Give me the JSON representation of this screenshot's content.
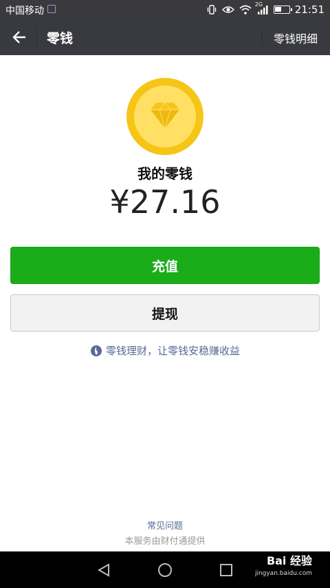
{
  "status_bar": {
    "carrier": "中国移动",
    "network": "2G",
    "battery_level": 0.45,
    "time": "21:51"
  },
  "title_bar": {
    "back_icon": "arrow-left-icon",
    "title": "零钱",
    "detail_link": "零钱明细"
  },
  "wallet": {
    "icon": "diamond-coin-icon",
    "label": "我的零钱",
    "balance": "¥27.16"
  },
  "actions": {
    "recharge_label": "充值",
    "withdraw_label": "提现"
  },
  "promo": {
    "icon": "licaitong-icon",
    "text": "零钱理财，让零钱安稳赚收益"
  },
  "footer": {
    "faq": "常见问题",
    "provider": "本服务由财付通提供"
  },
  "nav_bar": {
    "back": "triangle-back-icon",
    "home": "circle-home-icon",
    "recents": "square-recents-icon"
  },
  "watermark": {
    "brand": "Bai 经验",
    "url": "jingyan.baidu.com"
  },
  "colors": {
    "primary_green": "#1aad19",
    "title_bar": "#393a3f",
    "link_blue": "#576b95",
    "coin_gold": "#f5c518"
  }
}
